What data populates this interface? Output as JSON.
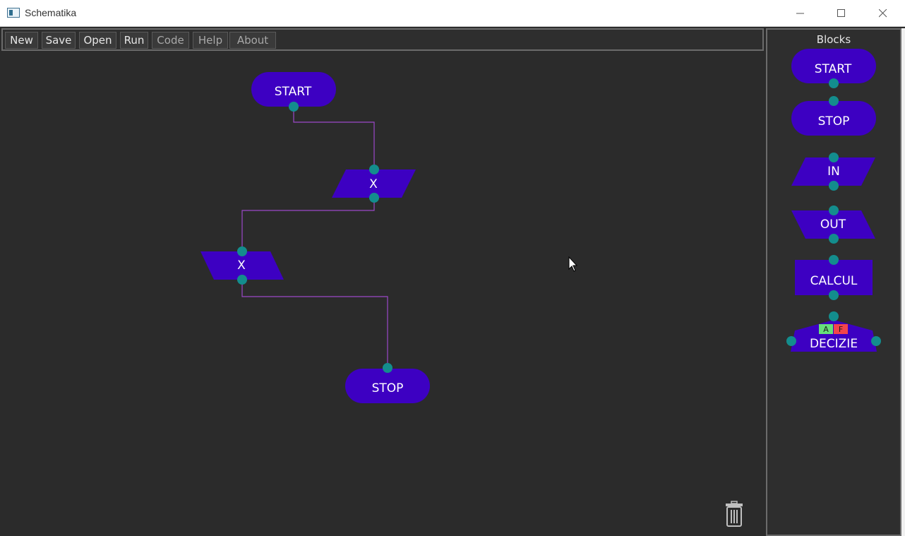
{
  "window": {
    "title": "Schematika"
  },
  "menu": {
    "new": "New",
    "save": "Save",
    "open": "Open",
    "run": "Run",
    "code": "Code",
    "help": "Help",
    "about": "About"
  },
  "canvas": {
    "blocks": {
      "start": "START",
      "input1": "X",
      "input2": "X",
      "stop": "STOP"
    }
  },
  "palette": {
    "title": "Blocks",
    "start": "START",
    "stop": "STOP",
    "in": "IN",
    "out": "OUT",
    "calcul": "CALCUL",
    "decizie": "DECIZIE",
    "decizie_true": "A",
    "decizie_false": "F"
  },
  "colors": {
    "block_fill": "#3d00c2",
    "connector": "#138d8d",
    "link_line": "#9b48c8",
    "true_tag": "#66e07a",
    "false_tag": "#f2454b"
  },
  "icons": {
    "app": "window-app-icon",
    "minimize": "minimize-icon",
    "maximize": "maximize-icon",
    "close": "close-icon",
    "cursor": "mouse-pointer-icon",
    "trash": "trash-icon"
  }
}
